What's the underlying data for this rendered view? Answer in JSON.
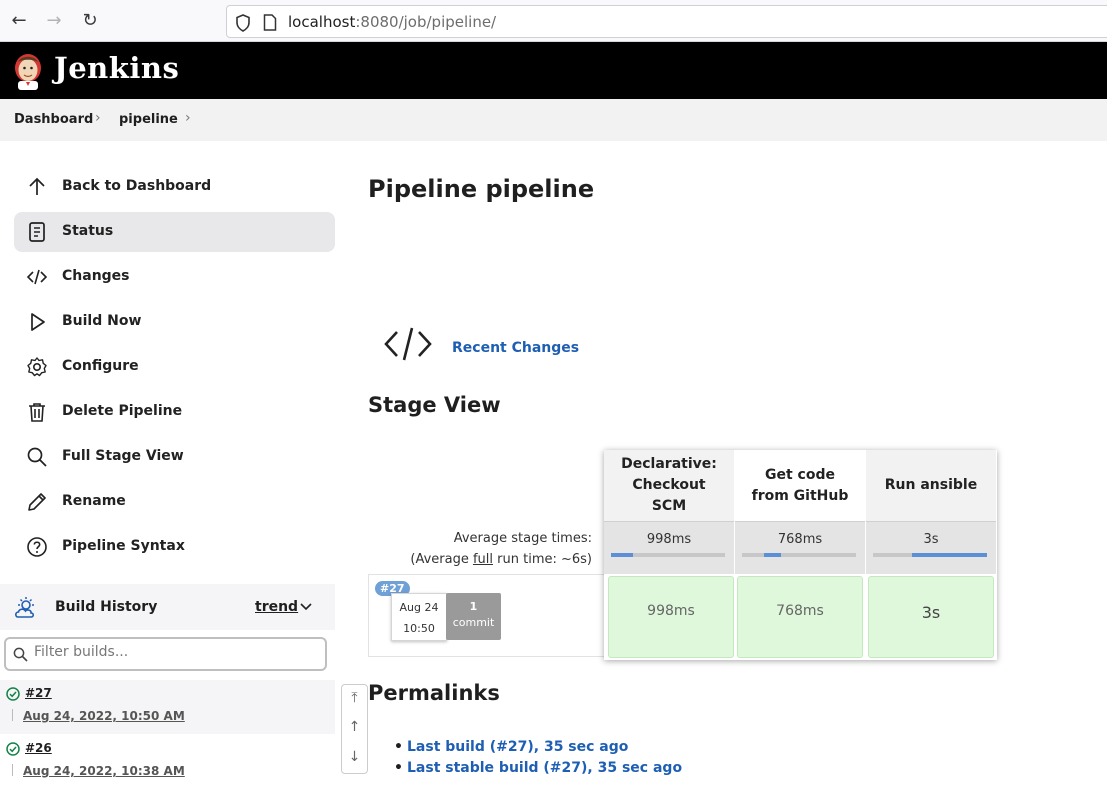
{
  "browser": {
    "back": "←",
    "forward": "→",
    "reload": "↻",
    "url_host": "localhost",
    "url_path": ":8080/job/pipeline/"
  },
  "header": {
    "title": "Jenkins"
  },
  "breadcrumb": {
    "items": [
      "Dashboard",
      "pipeline"
    ],
    "sep": "›"
  },
  "sidebar": {
    "items": [
      {
        "label": "Back to Dashboard"
      },
      {
        "label": "Status"
      },
      {
        "label": "Changes"
      },
      {
        "label": "Build Now"
      },
      {
        "label": "Configure"
      },
      {
        "label": "Delete Pipeline"
      },
      {
        "label": "Full Stage View"
      },
      {
        "label": "Rename"
      },
      {
        "label": "Pipeline Syntax"
      }
    ],
    "active_index": 1
  },
  "build_history": {
    "title": "Build History",
    "trend": "trend",
    "filter_placeholder": "Filter builds...",
    "builds": [
      {
        "number": "#27",
        "date": "Aug 24, 2022, 10:50 AM"
      },
      {
        "number": "#26",
        "date": "Aug 24, 2022, 10:38 AM"
      }
    ]
  },
  "main": {
    "title": "Pipeline pipeline",
    "recent_changes": "Recent Changes",
    "stage_view_title": "Stage View",
    "avg_label": "Average stage times:",
    "avg_full_prefix": "(Average ",
    "avg_full_word": "full",
    "avg_full_suffix": " run time: ~6s)",
    "stages": [
      {
        "name": "Declarative: Checkout SCM",
        "avg": "998ms",
        "cell": "998ms",
        "bar_offset": 0.0,
        "bar_fraction": 0.19
      },
      {
        "name": "Get code from GitHub",
        "avg": "768ms",
        "cell": "768ms",
        "bar_offset": 0.19,
        "bar_fraction": 0.15
      },
      {
        "name": "Run ansible",
        "avg": "3s",
        "cell": "3s",
        "bar_offset": 0.34,
        "bar_fraction": 0.66
      }
    ],
    "run": {
      "badge": "#27",
      "date": "Aug 24",
      "time": "10:50",
      "commit_count": "1",
      "commit_label": "commit"
    },
    "permalinks_title": "Permalinks",
    "permalinks": [
      "Last build (#27), 35 sec ago",
      "Last stable build (#27), 35 sec ago"
    ]
  },
  "scroll": {
    "top": "⤒",
    "up": "↑",
    "down": "↓"
  },
  "colors": {
    "header_bg": "#000000",
    "link": "#1e5fb3",
    "stage_success": "#dff8dc",
    "bar_fill": "#5b8fd6"
  }
}
